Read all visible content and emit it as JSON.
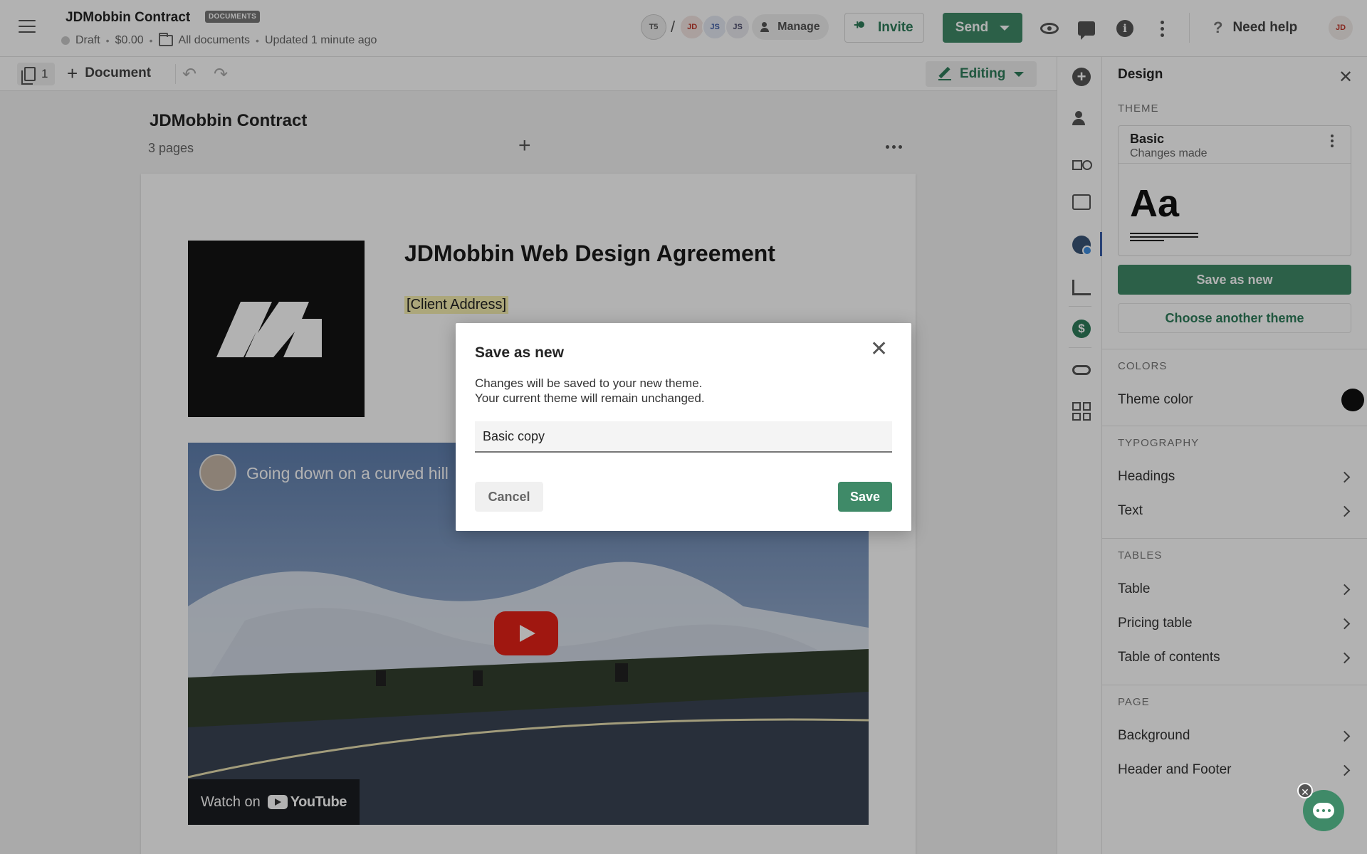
{
  "header": {
    "doc_title": "JDMobbin Contract",
    "badge": "DOCUMENTS",
    "status": "Draft",
    "amount": "$0.00",
    "folder": "All documents",
    "updated": "Updated 1 minute ago",
    "recipients": [
      "T5",
      "JD",
      "JS",
      "JS"
    ],
    "manage_label": "Manage",
    "invite_label": "Invite",
    "send_label": "Send",
    "help_label": "Need help",
    "user_initials": "JD"
  },
  "toolbar": {
    "page_count": "1",
    "add_document_label": "Document",
    "mode_label": "Editing"
  },
  "document": {
    "title": "JDMobbin Contract",
    "pages": "3 pages",
    "heading": "JDMobbin Web Design Agreement",
    "client_address": "[Client Address]",
    "video_title": "Going down on a curved hill",
    "watch_on": "Watch on",
    "youtube": "YouTube"
  },
  "panel": {
    "title": "Design",
    "theme_section": "THEME",
    "theme_name": "Basic",
    "theme_status": "Changes made",
    "theme_preview": "Aa",
    "save_as_new": "Save as new",
    "choose_theme": "Choose another theme",
    "colors_section": "COLORS",
    "theme_color_label": "Theme color",
    "theme_color": "#111111",
    "typography_section": "TYPOGRAPHY",
    "typography_items": [
      "Headings",
      "Text"
    ],
    "tables_section": "TABLES",
    "tables_items": [
      "Table",
      "Pricing table",
      "Table of contents"
    ],
    "page_section": "PAGE",
    "page_items": [
      "Background",
      "Header and Footer"
    ]
  },
  "modal": {
    "title": "Save as new",
    "line1": "Changes will be saved to your new theme.",
    "line2": "Your current theme will remain unchanged.",
    "input_value": "Basic copy",
    "cancel": "Cancel",
    "save": "Save"
  },
  "colors": {
    "accent": "#3f8a68",
    "accent_text": "#2e7d5b"
  }
}
